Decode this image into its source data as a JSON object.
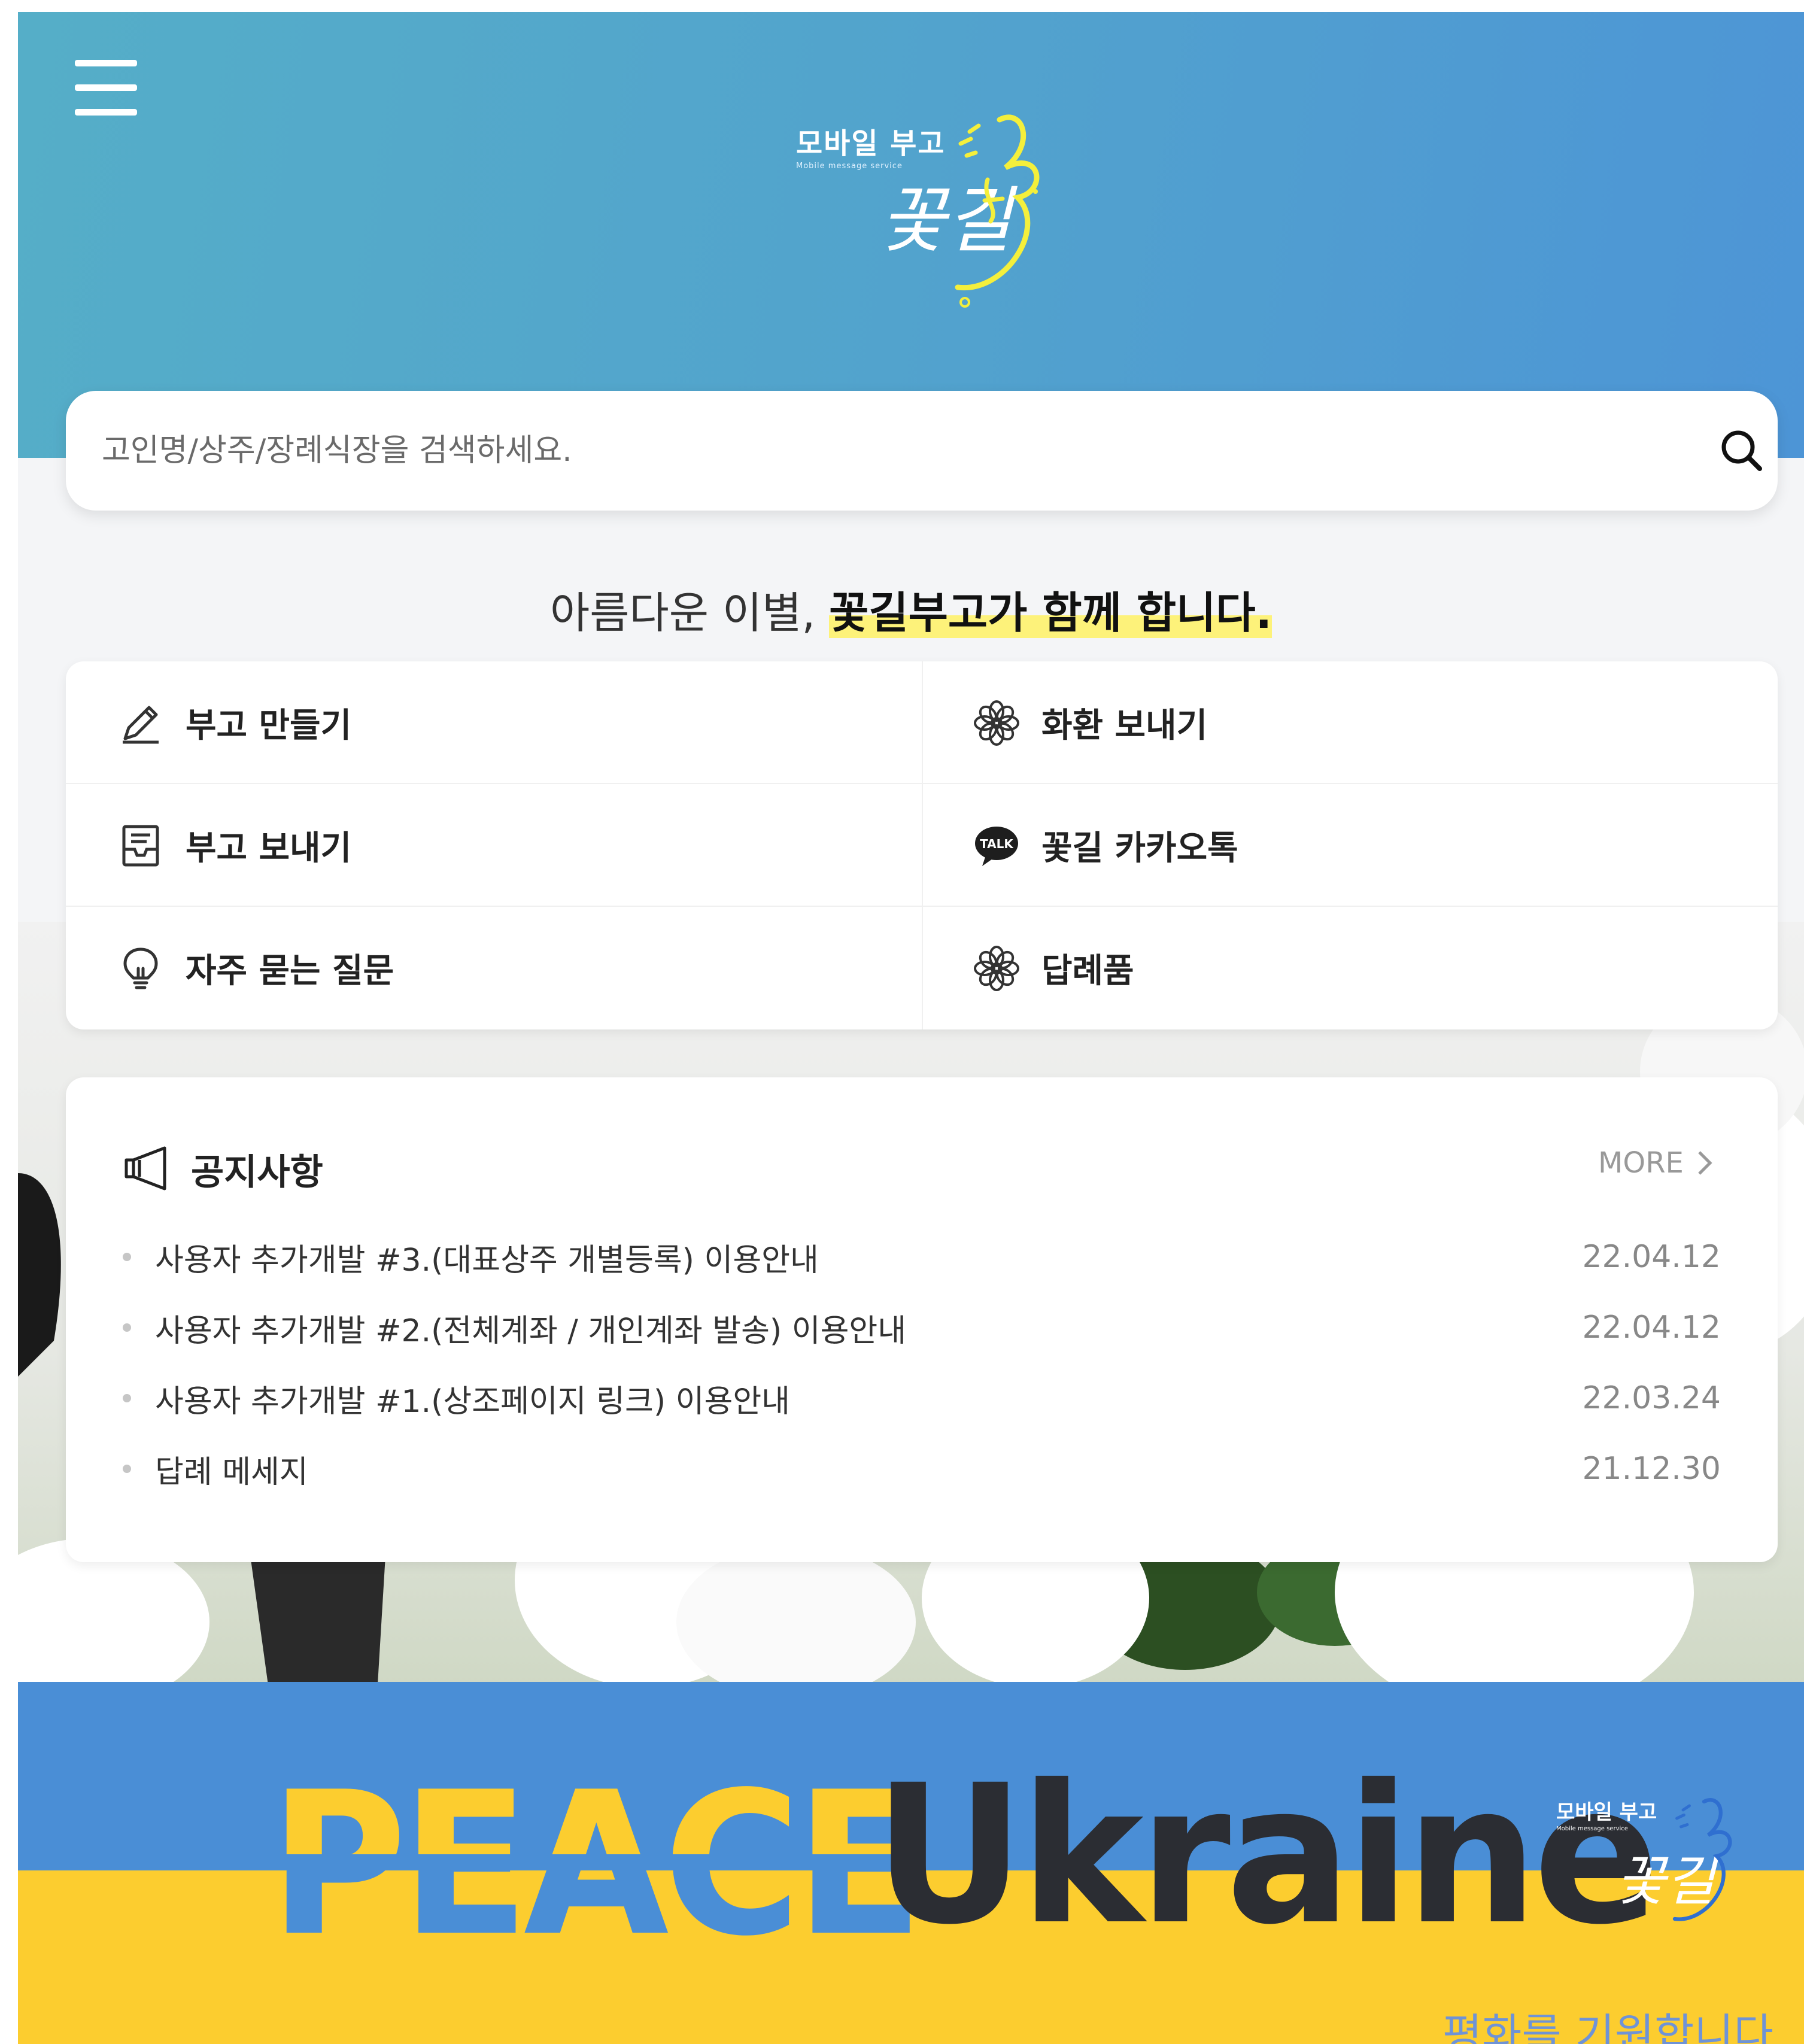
{
  "header": {
    "menu_icon": "hamburger-menu-icon",
    "logo_title": "모바일 부고",
    "logo_subtitle": "Mobile message service",
    "logo_script": "꽃길",
    "background_colors": [
      "#55aec8",
      "#4d95d6"
    ]
  },
  "search": {
    "placeholder": "고인명/상주/장례식장을 검색하세요.",
    "value": "",
    "icon": "search-icon"
  },
  "slogan": {
    "normal": "아름다운 이별, ",
    "highlight": "꽃길부고가 함께 합니다.",
    "highlight_color": "#fdf27a"
  },
  "quick_menu": {
    "items": [
      {
        "label": "부고 만들기",
        "icon": "pencil-icon"
      },
      {
        "label": "화환 보내기",
        "icon": "flower-icon"
      },
      {
        "label": "부고 보내기",
        "icon": "letter-tray-icon"
      },
      {
        "label": "꽃길 카카오톡",
        "icon": "kakaotalk-icon"
      },
      {
        "label": "자주 묻는 질문",
        "icon": "lightbulb-icon"
      },
      {
        "label": "답례품",
        "icon": "flower-icon"
      }
    ]
  },
  "notice": {
    "title": "공지사항",
    "icon": "megaphone-icon",
    "more_label": "MORE",
    "rows": [
      {
        "title": "사용자 추가개발 #3.(대표상주 개별등록) 이용안내",
        "date": "22.04.12"
      },
      {
        "title": "사용자 추가개발 #2.(전체계좌 / 개인계좌 발송) 이용안내",
        "date": "22.04.12"
      },
      {
        "title": "사용자 추가개발 #1.(상조페이지 링크) 이용안내",
        "date": "22.03.24"
      },
      {
        "title": "답례 메세지",
        "date": "21.12.30"
      }
    ]
  },
  "banner": {
    "word1": "PEACE",
    "word2": "Ukraine",
    "logo_title": "모바일 부고",
    "logo_subtitle": "Mobile message service",
    "logo_script": "꽃길",
    "message": "평화를 기원합니다.",
    "colors": {
      "blue": "#4a8ed6",
      "yellow": "#fccd2f"
    }
  }
}
